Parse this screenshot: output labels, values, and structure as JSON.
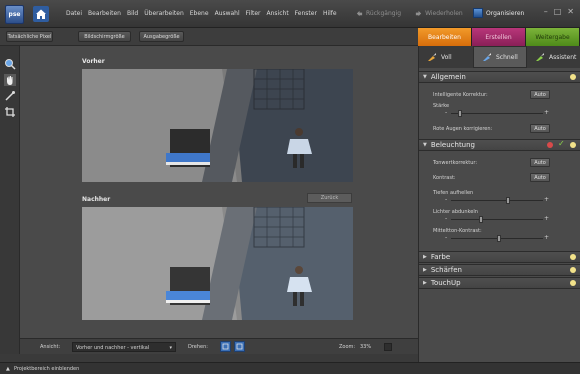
{
  "app": {
    "logo_text": "pse"
  },
  "menu": [
    "Datei",
    "Bearbeiten",
    "Bild",
    "Überarbeiten",
    "Ebene",
    "Auswahl",
    "Filter",
    "Ansicht",
    "Fenster",
    "Hilfe"
  ],
  "history": {
    "undo": "Rückgängig",
    "redo": "Wiederholen"
  },
  "organize": "Organisieren",
  "optbar": {
    "actual_pixels": "Tatsächliche Pixel",
    "fit_screen": "Bildschirmgröße",
    "print_size": "Ausgabegröße"
  },
  "tabs": {
    "edit": "Bearbeiten",
    "create": "Erstellen",
    "share": "Weitergabe"
  },
  "modes": {
    "full": "Voll",
    "quick": "Schnell",
    "guided": "Assistent"
  },
  "work": {
    "before": "Vorher",
    "after": "Nachher",
    "reset": "Zurück"
  },
  "bottom": {
    "view_label": "Ansicht:",
    "view_value": "Vorher und nachher - vertikal",
    "rotate_label": "Drehen:",
    "zoom_label": "Zoom:",
    "zoom_value": "33%"
  },
  "status": {
    "project_bin": "Projektbereich einblenden"
  },
  "panel": {
    "general": {
      "title": "Allgemein",
      "smart_fix": "Intelligente Korrektur:",
      "auto": "Auto",
      "amount": "Stärke",
      "amount_level": 0.08,
      "red_eye": "Rote Augen korrigieren:"
    },
    "lighting": {
      "title": "Beleuchtung",
      "levels": "Tonwertkorrektur:",
      "contrast": "Kontrast:",
      "auto": "Auto",
      "lighten_shadows": "Tiefen aufhellen",
      "shadows_level": 0.62,
      "darken_highlights": "Lichter abdunkeln",
      "highlights_level": 0.32,
      "midtone_contrast": "Mitteltton-Kontrast:",
      "midtone_level": 0.52
    },
    "color": {
      "title": "Farbe"
    },
    "sharpen": {
      "title": "Schärfen"
    },
    "touchup": {
      "title": "TouchUp"
    }
  }
}
